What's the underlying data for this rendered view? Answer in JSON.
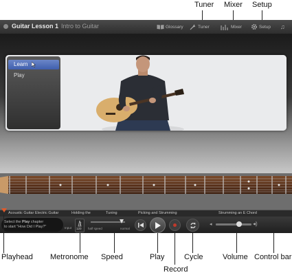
{
  "callouts": {
    "tuner": "Tuner",
    "mixer": "Mixer",
    "setup": "Setup",
    "playhead": "Playhead",
    "metronome": "Metronome",
    "speed": "Speed",
    "play": "Play",
    "record": "Record",
    "cycle": "Cycle",
    "volume": "Volume",
    "control_bar": "Control bar"
  },
  "titlebar": {
    "lesson_title": "Guitar Lesson 1",
    "lesson_subtitle": "Intro to Guitar",
    "glossary": "Glossary",
    "tuner": "Tuner",
    "mixer": "Mixer",
    "setup": "Setup"
  },
  "menu": {
    "items": [
      {
        "label": "Learn",
        "selected": true
      },
      {
        "label": "Play",
        "selected": false
      }
    ]
  },
  "chapters": [
    "Acoustic Guitar  Electric Guitar",
    "Holding the",
    "Tuning",
    "Picking and Strumming",
    "Strumming an E Chord"
  ],
  "controls": {
    "hint_line1_pre": "Select the ",
    "hint_bold": "Play",
    "hint_line1_post": " chapter",
    "hint_line2": "to start \"How Did I Play?\"",
    "metronome_label": "Input",
    "metronome_value": "120",
    "speed_half": "half speed",
    "speed_normal": "normal"
  },
  "colors": {
    "record": "#c0392b",
    "selection": "#4a68b8"
  },
  "icons": {
    "glossary": "book-icon",
    "tuner": "tuning-fork-icon",
    "mixer": "mixer-icon",
    "setup": "gear-icon",
    "notes": "music-note-icon"
  }
}
